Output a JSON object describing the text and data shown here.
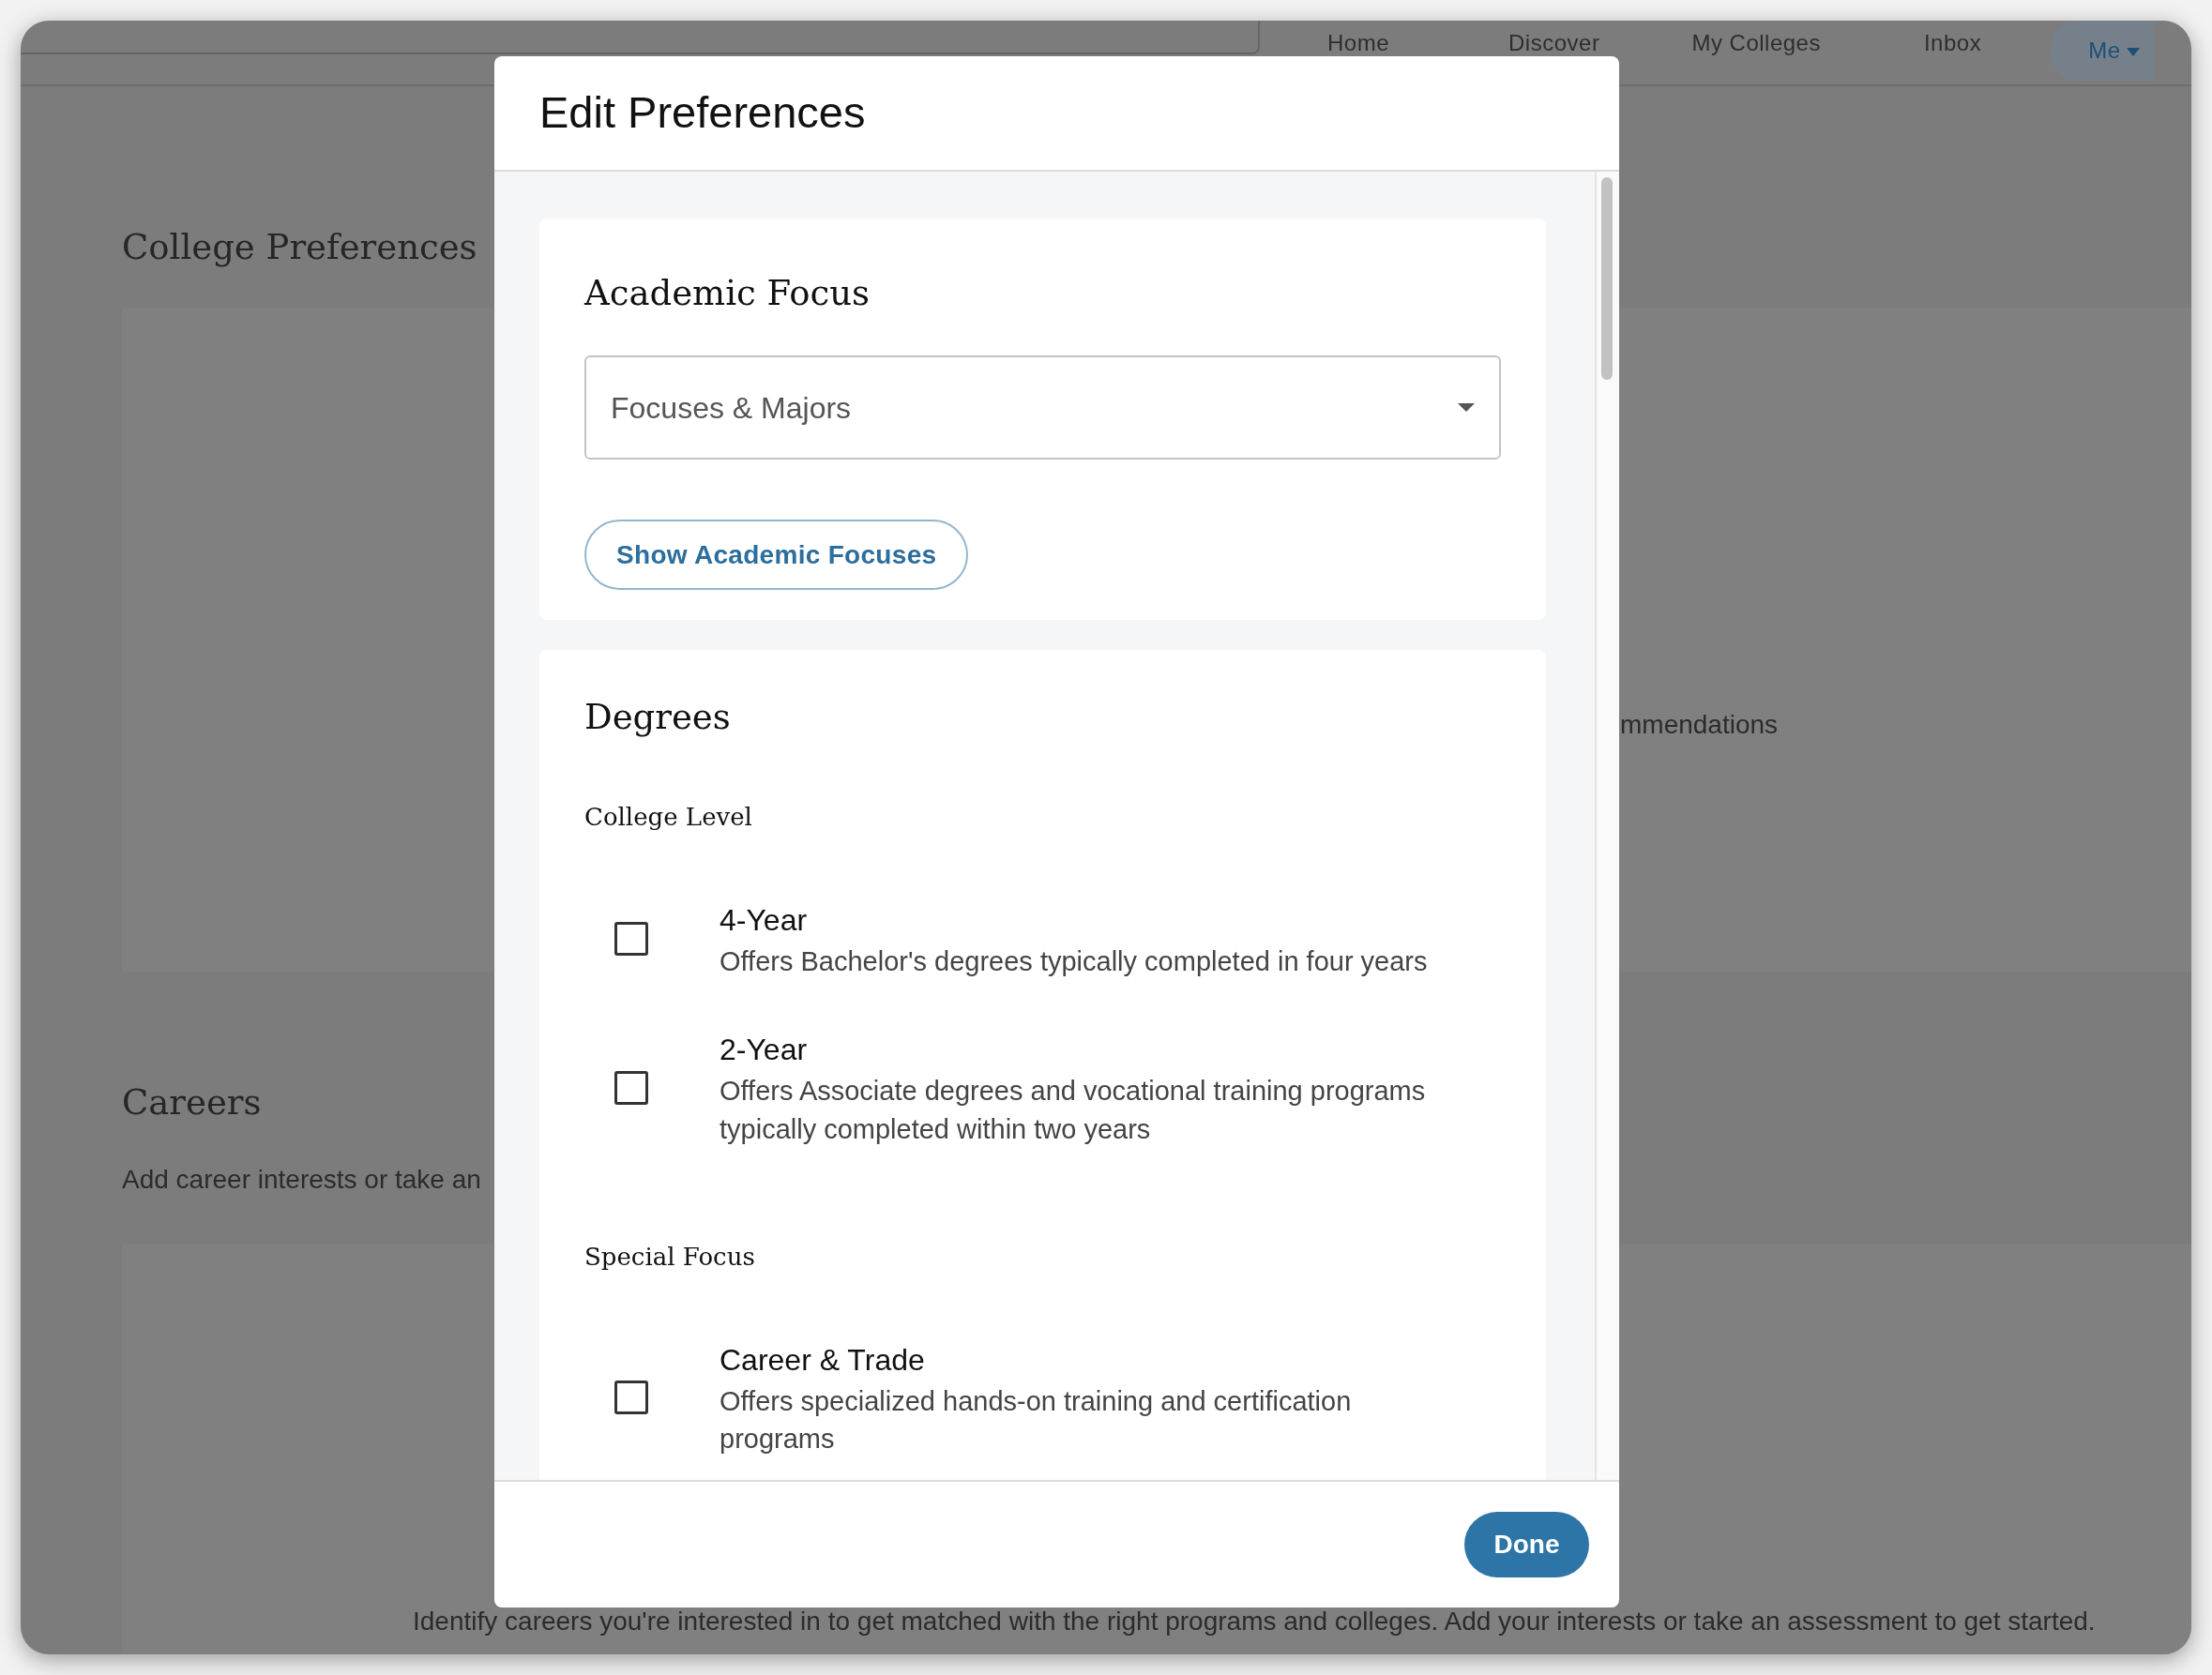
{
  "nav": {
    "items": [
      {
        "label": "Home",
        "selected": false
      },
      {
        "label": "Discover",
        "selected": false
      },
      {
        "label": "My Colleges",
        "selected": false
      },
      {
        "label": "Inbox",
        "selected": false
      },
      {
        "label": "Me",
        "selected": true
      }
    ]
  },
  "page": {
    "sections": [
      {
        "title": "College Preferences",
        "description": "mmendations"
      },
      {
        "title": "Careers",
        "description": "Add career interests or take an",
        "footer_text": "Identify careers you're interested in to get matched with the right programs and colleges. Add your interests or take an assessment to get started."
      }
    ]
  },
  "modal": {
    "title": "Edit Preferences",
    "sections": [
      {
        "kind": "select",
        "title": "Academic Focus",
        "select": {
          "placeholder": "Focuses & Majors"
        },
        "button": "Show Academic Focuses"
      },
      {
        "kind": "checklist",
        "title": "Degrees",
        "groups": [
          {
            "label": "College Level",
            "options": [
              {
                "title": "4-Year",
                "description": "Offers Bachelor's degrees typically completed in four years",
                "checked": false
              },
              {
                "title": "2-Year",
                "description": "Offers Associate degrees and vocational training programs typically completed within two years",
                "checked": false
              }
            ]
          },
          {
            "label": "Special Focus",
            "options": [
              {
                "title": "Career & Trade",
                "description": "Offers specialized hands-on training and certification programs",
                "checked": false
              }
            ]
          }
        ]
      }
    ],
    "done_button": "Done"
  }
}
